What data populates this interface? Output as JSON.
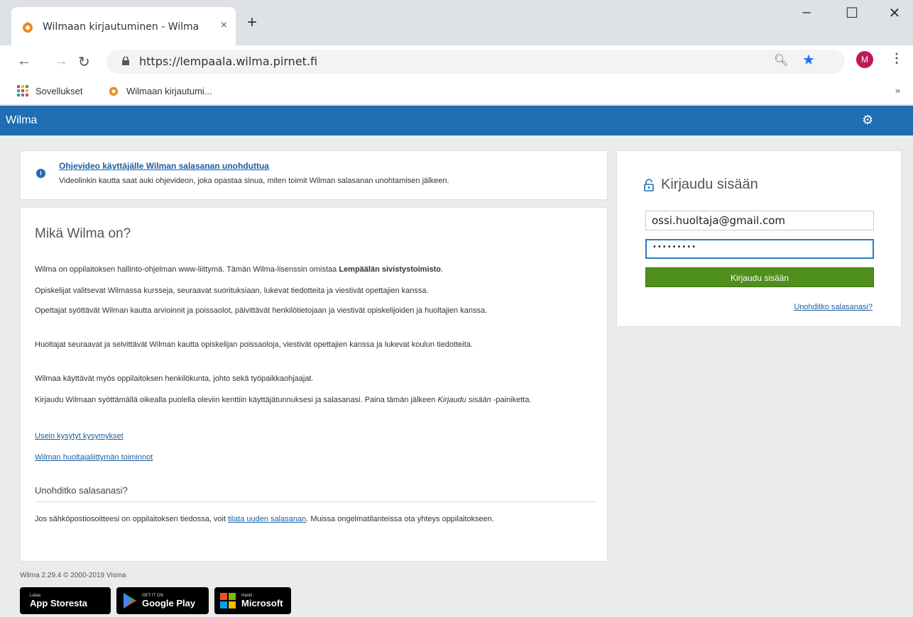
{
  "browser": {
    "tab_title": "Wilmaan kirjautuminen - Wilma",
    "tab_close": "×",
    "new_tab": "+",
    "url_host": "https://lempaala.wilma.pirnet.fi",
    "bookmarks": [
      {
        "label": "Sovellukset"
      },
      {
        "label": "Wilmaan kirjautumi..."
      }
    ],
    "bookmarks_more": "»",
    "avatar_letter": "M",
    "window": {
      "minimize": "–",
      "maximize": "☐",
      "close": "✕"
    }
  },
  "header": {
    "title": "Wilma",
    "user_icon": "user-settings-icon"
  },
  "info": {
    "link": "Ohjevideo käyttäjälle Wilman salasanan unohduttua",
    "text": "Videolinkin kautta saat auki ohjevideon, joka opastaa sinua, miten toimit Wilman salasanan unohtamisen jälkeen."
  },
  "main": {
    "heading": "Mikä Wilma on?",
    "p1_start": "Wilma on oppilaitoksen hallinto-ohjelman www-liittymä. Tämän Wilma-lisenssin omistaa ",
    "p1_bold": "Lempäälän sivistystoimisto",
    "p1_end": ".",
    "p2": "Opiskelijat valitsevat Wilmassa kursseja, seuraavat suorituksiaan, lukevat tiedotteita ja viestivät opettajien kanssa.",
    "p3": "Opettajat syöttävät Wilman kautta arvioinnit ja poissaolot, päivittävät henkilötietojaan ja viestivät opiskelijoiden ja huoltajien kanssa.",
    "p4": "Huoltajat seuraavat ja selvittävät Wilman kautta opiskelijan poissaoloja, viestivät opettajien kanssa ja lukevat koulun tiedotteita.",
    "p5": "Wilmaa käyttävät myös oppilaitoksen henkilökunta, johto sekä työpaikkaohjaajat.",
    "p6_start": "Kirjaudu Wilmaan syöttämällä oikealla puolella oleviin kenttiin käyttäjätunnuksesi ja salasanasi. Paina tämän jälkeen ",
    "p6_italic": "Kirjaudu sisään",
    "p6_end": " -painiketta.",
    "link1": "Usein kysytyt kysymykset",
    "link2": "Wilman huoltajaliittymän toiminnot",
    "forgot_heading": "Unohditko salasanasi?",
    "forgot_start": "Jos sähköpostiosoitteesi on oppilaitoksen tiedossa, voit ",
    "forgot_link": "tilata uuden salasanan",
    "forgot_end": ". Muissa ongelmatilanteissa ota yhteys oppilaitokseen."
  },
  "login": {
    "title": "Kirjaudu sisään",
    "username": "ossi.huoltaja@gmail.com",
    "password_mask": "•••••••••",
    "button": "Kirjaudu sisään",
    "forgot": "Unohditko salasanasi?"
  },
  "footer": {
    "version": "Wilma 2.29.4 © 2000-2019 Visma",
    "badges": [
      {
        "small": "Lataa",
        "big": "App Storesta"
      },
      {
        "small": "GET IT ON",
        "big": "Google Play"
      },
      {
        "small": "Hanki",
        "big": "Microsoft"
      }
    ]
  }
}
